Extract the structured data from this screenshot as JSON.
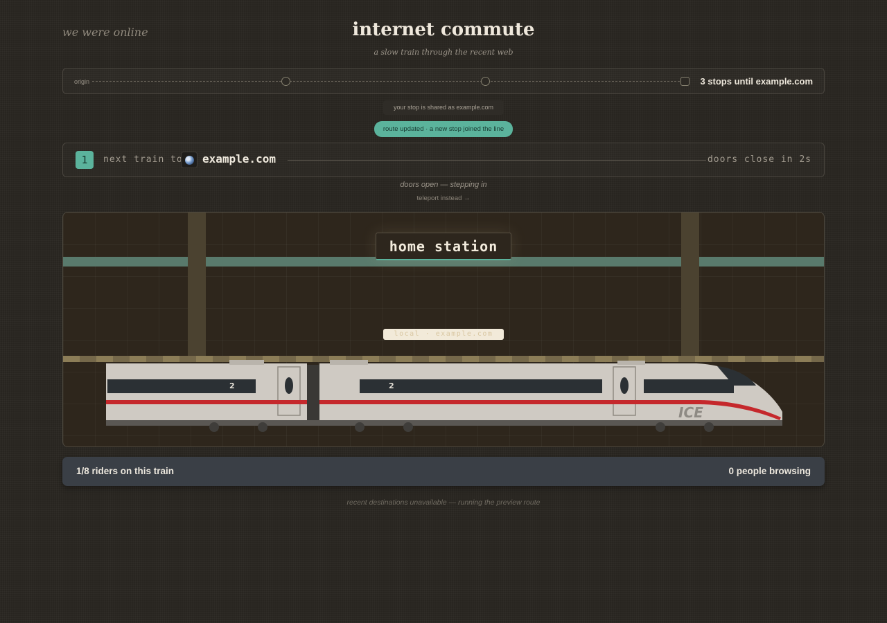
{
  "header": {
    "brand": "we were online",
    "title": "internet commute",
    "subtitle": "a slow train through the recent web"
  },
  "route": {
    "origin_label": "origin",
    "stops_label": "3 stops until example.com"
  },
  "notices": {
    "shared_stop": "your stop is shared as example.com",
    "toast": "route updated · a new stop joined the line"
  },
  "next_train": {
    "number": "1",
    "label": "next train to",
    "favicon_icon": "globe-icon",
    "destination": "example.com",
    "doors_close": "doors close in 2s"
  },
  "status": {
    "doors_open": "doors open — stepping in",
    "teleport": "teleport instead →"
  },
  "station": {
    "sign": "home station",
    "platform_label": "local · example.com",
    "train_logo": "ICE",
    "train_car_class": "2",
    "colors": {
      "accent": "#5bb39c",
      "band": "#597a6c",
      "train_stripe": "#c5282c"
    }
  },
  "riders": {
    "count": "1/8 riders on this train",
    "browsing": "0 people browsing"
  },
  "footer": {
    "note": "recent destinations unavailable — running the preview route"
  }
}
